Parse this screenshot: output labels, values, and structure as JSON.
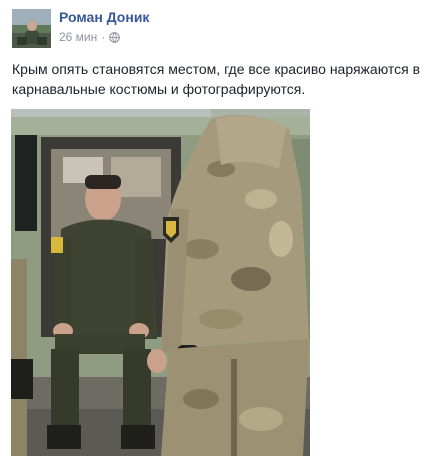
{
  "post": {
    "author": "Роман Доник",
    "time": "26 мин",
    "separator": "·",
    "privacy_icon": "globe-icon",
    "text_line1": "Крым опять становятся местом, где все красиво наряжаются в",
    "text_line2": "карнавальные костюмы и фотографируются."
  },
  "colors": {
    "author_link": "#365899",
    "meta_text": "#90949c",
    "body_text": "#1d2129"
  }
}
